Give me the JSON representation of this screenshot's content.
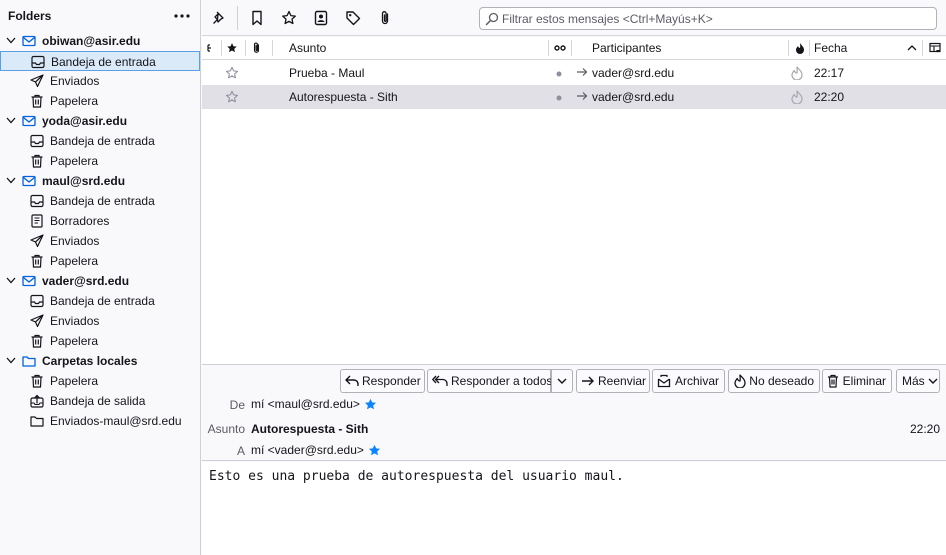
{
  "folders": {
    "title": "Folders",
    "menu_icon": "more-horizontal-icon",
    "items": [
      {
        "label": "obiwan@asir.edu",
        "type": "account",
        "icon": "envelope-icon"
      },
      {
        "label": "Bandeja de entrada",
        "type": "inbox",
        "icon": "inbox-icon",
        "selected": true
      },
      {
        "label": "Enviados",
        "type": "sent",
        "icon": "send-icon"
      },
      {
        "label": "Papelera",
        "type": "trash",
        "icon": "trash-icon"
      },
      {
        "label": "yoda@asir.edu",
        "type": "account",
        "icon": "envelope-icon"
      },
      {
        "label": "Bandeja de entrada",
        "type": "inbox",
        "icon": "inbox-icon"
      },
      {
        "label": "Papelera",
        "type": "trash",
        "icon": "trash-icon"
      },
      {
        "label": "maul@srd.edu",
        "type": "account",
        "icon": "envelope-icon"
      },
      {
        "label": "Bandeja de entrada",
        "type": "inbox",
        "icon": "inbox-icon"
      },
      {
        "label": "Borradores",
        "type": "drafts",
        "icon": "draft-icon"
      },
      {
        "label": "Enviados",
        "type": "sent",
        "icon": "send-icon"
      },
      {
        "label": "Papelera",
        "type": "trash",
        "icon": "trash-icon"
      },
      {
        "label": "vader@srd.edu",
        "type": "account",
        "icon": "envelope-icon"
      },
      {
        "label": "Bandeja de entrada",
        "type": "inbox",
        "icon": "inbox-icon"
      },
      {
        "label": "Enviados",
        "type": "sent",
        "icon": "send-icon"
      },
      {
        "label": "Papelera",
        "type": "trash",
        "icon": "trash-icon"
      },
      {
        "label": "Carpetas locales",
        "type": "account-local",
        "icon": "folder-icon"
      },
      {
        "label": "Papelera",
        "type": "trash",
        "icon": "trash-icon"
      },
      {
        "label": "Bandeja de salida",
        "type": "outbox",
        "icon": "outbox-icon"
      },
      {
        "label": "Enviados-maul@srd.edu",
        "type": "folder",
        "icon": "folder-icon"
      }
    ]
  },
  "toolbar": {
    "quick_filter_icons": [
      "pin-icon",
      "unread-bookmark-icon",
      "star-icon",
      "contact-card-icon",
      "tag-icon",
      "attachment-icon"
    ],
    "search_placeholder": "Filtrar estos mensajes <Ctrl+Mayús+K>",
    "search_value": ""
  },
  "thread_list": {
    "columns": {
      "subject": "Asunto",
      "correspondents": "Participantes",
      "date": "Fecha"
    },
    "rows": [
      {
        "subject": "Prueba - Maul",
        "correspondent": "vader@srd.edu",
        "date": "22:17",
        "selected": false
      },
      {
        "subject": "Autorespuesta - Sith",
        "correspondent": "vader@srd.edu",
        "date": "22:20",
        "selected": true
      }
    ]
  },
  "message_header": {
    "buttons": {
      "reply": "Responder",
      "reply_all": "Responder a todos",
      "forward": "Reenviar",
      "archive": "Archivar",
      "junk": "No deseado",
      "delete": "Eliminar",
      "more": "Más"
    },
    "from_label": "De",
    "from_value": "mí <maul@srd.edu>",
    "subject_label": "Asunto",
    "subject_value": "Autorespuesta - Sith",
    "to_label": "A",
    "to_value": "mí <vader@srd.edu>",
    "date_value": "22:20"
  },
  "message_body": {
    "text": "Esto es una prueba de autorespuesta del usuario maul."
  },
  "colors": {
    "accent": "#0061e0",
    "selected_folder_bg": "#dbeaf9",
    "selected_row_bg": "#e0e0e6",
    "star_blue": "#0a84ff"
  }
}
